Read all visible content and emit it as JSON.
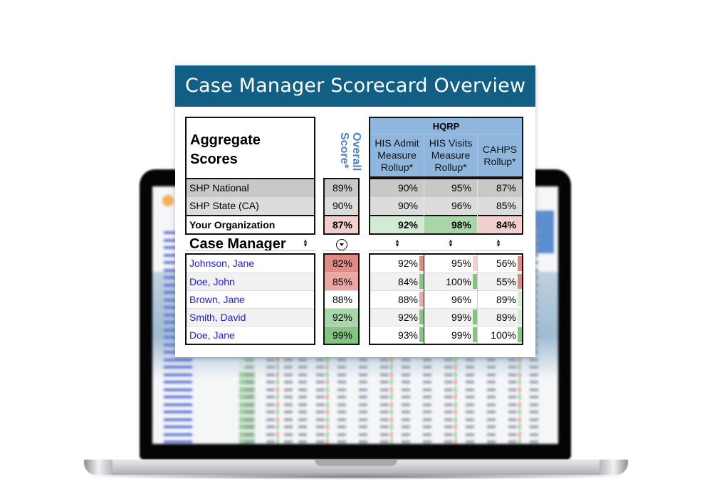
{
  "card": {
    "title": "Case Manager Scorecard Overview"
  },
  "aggregate": {
    "label_line1": "Aggregate",
    "label_line2": "Scores",
    "overall_header": "Overall Score*",
    "hqrp_title": "HQRP",
    "hqrp_columns": [
      "HIS Admit Measure Rollup*",
      "HIS Visits Measure Rollup*",
      "CAHPS Rollup*"
    ],
    "rows": [
      {
        "name": "SHP National",
        "overall": "89%",
        "his_admit": "90%",
        "his_visits": "95%",
        "cahps": "87%"
      },
      {
        "name": "SHP State (CA)",
        "overall": "90%",
        "his_admit": "90%",
        "his_visits": "96%",
        "cahps": "85%"
      },
      {
        "name": "Your Organization",
        "overall": "87%",
        "his_admit": "92%",
        "his_visits": "98%",
        "cahps": "84%"
      }
    ]
  },
  "case_managers": {
    "heading": "Case Manager",
    "sort_icon": "sort-updown-icon",
    "overall_sort_icon": "circle-chevron-down-icon",
    "rows": [
      {
        "name": "Johnson, Jane",
        "overall": "82%",
        "his_admit": "92%",
        "his_visits": "95%",
        "cahps": "56%"
      },
      {
        "name": "Doe, John",
        "overall": "85%",
        "his_admit": "84%",
        "his_visits": "100%",
        "cahps": "55%"
      },
      {
        "name": "Brown, Jane",
        "overall": "88%",
        "his_admit": "88%",
        "his_visits": "96%",
        "cahps": "89%"
      },
      {
        "name": "Smith, David",
        "overall": "92%",
        "his_admit": "92%",
        "his_visits": "99%",
        "cahps": "89%"
      },
      {
        "name": "Doe, Jane",
        "overall": "99%",
        "his_admit": "93%",
        "his_visits": "99%",
        "cahps": "100%"
      }
    ]
  },
  "colors": {
    "header_bg": "#125f86",
    "hqrp_bg": "#8fb6dd",
    "overall_header_text": "#4e84bd",
    "link_text": "#1f1fe0",
    "red_strong": "#e08a86",
    "red_medium": "#eaa8a5",
    "red_light": "#f2cfcf",
    "green_light": "#d3ebd3",
    "green_medium": "#a8d6a8",
    "green_strong": "#83c483"
  }
}
